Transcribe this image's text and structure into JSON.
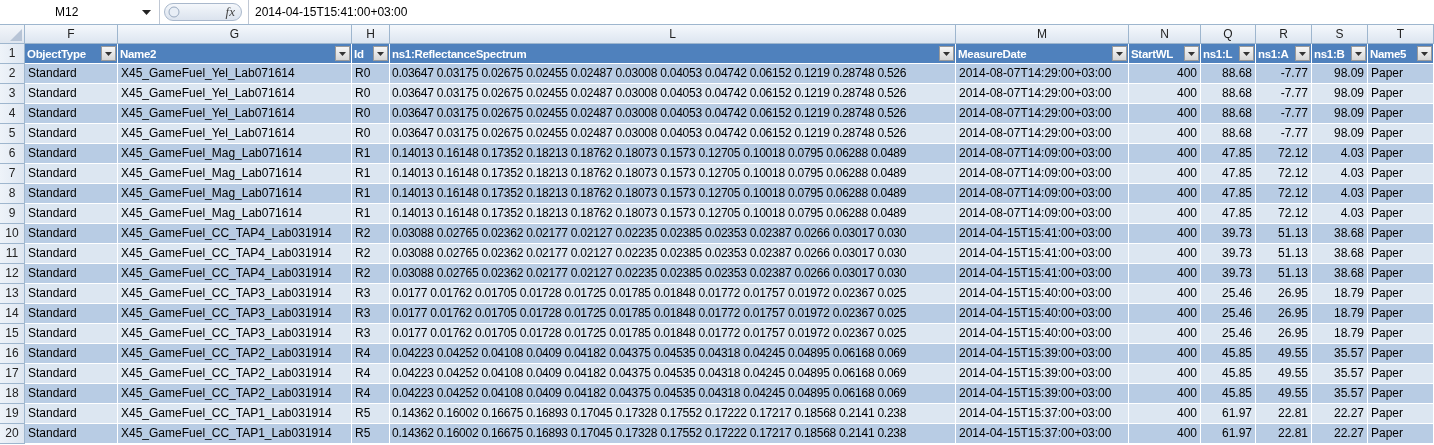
{
  "formula_bar": {
    "name_box": "M12",
    "function_label": "fx",
    "formula": "2014-04-15T15:41:00+03:00"
  },
  "column_letters": [
    "F",
    "G",
    "H",
    "L",
    "M",
    "N",
    "Q",
    "R",
    "S",
    "T"
  ],
  "header_row": {
    "row": "1",
    "cells": [
      "ObjectType",
      "Name2",
      "Id",
      "ns1:ReflectanceSpectrum",
      "MeasureDate",
      "StartWL",
      "ns1:L",
      "ns1:A",
      "ns1:B",
      "Name5"
    ]
  },
  "rows": [
    {
      "row": "2",
      "cells": [
        "Standard",
        "X45_GameFuel_Yel_Lab071614",
        "R0",
        "0.03647 0.03175 0.02675 0.02455 0.02487 0.03008 0.04053 0.04742 0.06152 0.1219 0.28748 0.526",
        "2014-08-07T14:29:00+03:00",
        "400",
        "88.68",
        "-7.77",
        "98.09",
        "Paper"
      ]
    },
    {
      "row": "3",
      "cells": [
        "Standard",
        "X45_GameFuel_Yel_Lab071614",
        "R0",
        "0.03647 0.03175 0.02675 0.02455 0.02487 0.03008 0.04053 0.04742 0.06152 0.1219 0.28748 0.526",
        "2014-08-07T14:29:00+03:00",
        "400",
        "88.68",
        "-7.77",
        "98.09",
        "Paper"
      ]
    },
    {
      "row": "4",
      "cells": [
        "Standard",
        "X45_GameFuel_Yel_Lab071614",
        "R0",
        "0.03647 0.03175 0.02675 0.02455 0.02487 0.03008 0.04053 0.04742 0.06152 0.1219 0.28748 0.526",
        "2014-08-07T14:29:00+03:00",
        "400",
        "88.68",
        "-7.77",
        "98.09",
        "Paper"
      ]
    },
    {
      "row": "5",
      "cells": [
        "Standard",
        "X45_GameFuel_Yel_Lab071614",
        "R0",
        "0.03647 0.03175 0.02675 0.02455 0.02487 0.03008 0.04053 0.04742 0.06152 0.1219 0.28748 0.526",
        "2014-08-07T14:29:00+03:00",
        "400",
        "88.68",
        "-7.77",
        "98.09",
        "Paper"
      ]
    },
    {
      "row": "6",
      "cells": [
        "Standard",
        "X45_GameFuel_Mag_Lab071614",
        "R1",
        "0.14013 0.16148 0.17352 0.18213 0.18762 0.18073 0.1573 0.12705 0.10018 0.0795 0.06288 0.0489",
        "2014-08-07T14:09:00+03:00",
        "400",
        "47.85",
        "72.12",
        "4.03",
        "Paper"
      ]
    },
    {
      "row": "7",
      "cells": [
        "Standard",
        "X45_GameFuel_Mag_Lab071614",
        "R1",
        "0.14013 0.16148 0.17352 0.18213 0.18762 0.18073 0.1573 0.12705 0.10018 0.0795 0.06288 0.0489",
        "2014-08-07T14:09:00+03:00",
        "400",
        "47.85",
        "72.12",
        "4.03",
        "Paper"
      ]
    },
    {
      "row": "8",
      "cells": [
        "Standard",
        "X45_GameFuel_Mag_Lab071614",
        "R1",
        "0.14013 0.16148 0.17352 0.18213 0.18762 0.18073 0.1573 0.12705 0.10018 0.0795 0.06288 0.0489",
        "2014-08-07T14:09:00+03:00",
        "400",
        "47.85",
        "72.12",
        "4.03",
        "Paper"
      ]
    },
    {
      "row": "9",
      "cells": [
        "Standard",
        "X45_GameFuel_Mag_Lab071614",
        "R1",
        "0.14013 0.16148 0.17352 0.18213 0.18762 0.18073 0.1573 0.12705 0.10018 0.0795 0.06288 0.0489",
        "2014-08-07T14:09:00+03:00",
        "400",
        "47.85",
        "72.12",
        "4.03",
        "Paper"
      ]
    },
    {
      "row": "10",
      "cells": [
        "Standard",
        "X45_GameFuel_CC_TAP4_Lab031914",
        "R2",
        "0.03088 0.02765 0.02362 0.02177 0.02127 0.02235 0.02385 0.02353 0.02387 0.0266 0.03017 0.030",
        "2014-04-15T15:41:00+03:00",
        "400",
        "39.73",
        "51.13",
        "38.68",
        "Paper"
      ]
    },
    {
      "row": "11",
      "cells": [
        "Standard",
        "X45_GameFuel_CC_TAP4_Lab031914",
        "R2",
        "0.03088 0.02765 0.02362 0.02177 0.02127 0.02235 0.02385 0.02353 0.02387 0.0266 0.03017 0.030",
        "2014-04-15T15:41:00+03:00",
        "400",
        "39.73",
        "51.13",
        "38.68",
        "Paper"
      ]
    },
    {
      "row": "12",
      "cells": [
        "Standard",
        "X45_GameFuel_CC_TAP4_Lab031914",
        "R2",
        "0.03088 0.02765 0.02362 0.02177 0.02127 0.02235 0.02385 0.02353 0.02387 0.0266 0.03017 0.030",
        "2014-04-15T15:41:00+03:00",
        "400",
        "39.73",
        "51.13",
        "38.68",
        "Paper"
      ]
    },
    {
      "row": "13",
      "cells": [
        "Standard",
        "X45_GameFuel_CC_TAP3_Lab031914",
        "R3",
        "0.0177 0.01762 0.01705 0.01728 0.01725 0.01785 0.01848 0.01772 0.01757 0.01972 0.02367 0.025",
        "2014-04-15T15:40:00+03:00",
        "400",
        "25.46",
        "26.95",
        "18.79",
        "Paper"
      ]
    },
    {
      "row": "14",
      "cells": [
        "Standard",
        "X45_GameFuel_CC_TAP3_Lab031914",
        "R3",
        "0.0177 0.01762 0.01705 0.01728 0.01725 0.01785 0.01848 0.01772 0.01757 0.01972 0.02367 0.025",
        "2014-04-15T15:40:00+03:00",
        "400",
        "25.46",
        "26.95",
        "18.79",
        "Paper"
      ]
    },
    {
      "row": "15",
      "cells": [
        "Standard",
        "X45_GameFuel_CC_TAP3_Lab031914",
        "R3",
        "0.0177 0.01762 0.01705 0.01728 0.01725 0.01785 0.01848 0.01772 0.01757 0.01972 0.02367 0.025",
        "2014-04-15T15:40:00+03:00",
        "400",
        "25.46",
        "26.95",
        "18.79",
        "Paper"
      ]
    },
    {
      "row": "16",
      "cells": [
        "Standard",
        "X45_GameFuel_CC_TAP2_Lab031914",
        "R4",
        "0.04223 0.04252 0.04108 0.0409 0.04182 0.04375 0.04535 0.04318 0.04245 0.04895 0.06168 0.069",
        "2014-04-15T15:39:00+03:00",
        "400",
        "45.85",
        "49.55",
        "35.57",
        "Paper"
      ]
    },
    {
      "row": "17",
      "cells": [
        "Standard",
        "X45_GameFuel_CC_TAP2_Lab031914",
        "R4",
        "0.04223 0.04252 0.04108 0.0409 0.04182 0.04375 0.04535 0.04318 0.04245 0.04895 0.06168 0.069",
        "2014-04-15T15:39:00+03:00",
        "400",
        "45.85",
        "49.55",
        "35.57",
        "Paper"
      ]
    },
    {
      "row": "18",
      "cells": [
        "Standard",
        "X45_GameFuel_CC_TAP2_Lab031914",
        "R4",
        "0.04223 0.04252 0.04108 0.0409 0.04182 0.04375 0.04535 0.04318 0.04245 0.04895 0.06168 0.069",
        "2014-04-15T15:39:00+03:00",
        "400",
        "45.85",
        "49.55",
        "35.57",
        "Paper"
      ]
    },
    {
      "row": "19",
      "cells": [
        "Standard",
        "X45_GameFuel_CC_TAP1_Lab031914",
        "R5",
        "0.14362 0.16002 0.16675 0.16893 0.17045 0.17328 0.17552 0.17222 0.17217 0.18568 0.2141 0.238",
        "2014-04-15T15:37:00+03:00",
        "400",
        "61.97",
        "22.81",
        "22.27",
        "Paper"
      ]
    },
    {
      "row": "20",
      "cells": [
        "Standard",
        "X45_GameFuel_CC_TAP1_Lab031914",
        "R5",
        "0.14362 0.16002 0.16675 0.16893 0.17045 0.17328 0.17552 0.17222 0.17217 0.18568 0.2141 0.238",
        "2014-04-15T15:37:00+03:00",
        "400",
        "61.97",
        "22.81",
        "22.27",
        "Paper"
      ]
    }
  ]
}
